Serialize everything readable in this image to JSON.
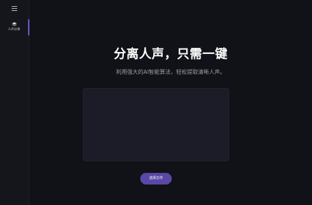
{
  "sidebar": {
    "menu_icon": "hamburger-menu-icon",
    "items": [
      {
        "label": "人声分离",
        "icon": "layers-icon",
        "active": true
      }
    ],
    "accent_color": "#6e5bd4"
  },
  "main": {
    "title": "分离人声，只需一键",
    "subtitle": "利用强大的AI智能算法，轻松提取清晰人声。",
    "choose_file_label": "选择文件"
  },
  "colors": {
    "background": "#111217",
    "sidebar_background": "#15161c",
    "dropzone_background": "#1b1c27",
    "button_background": "#5b47a6"
  }
}
